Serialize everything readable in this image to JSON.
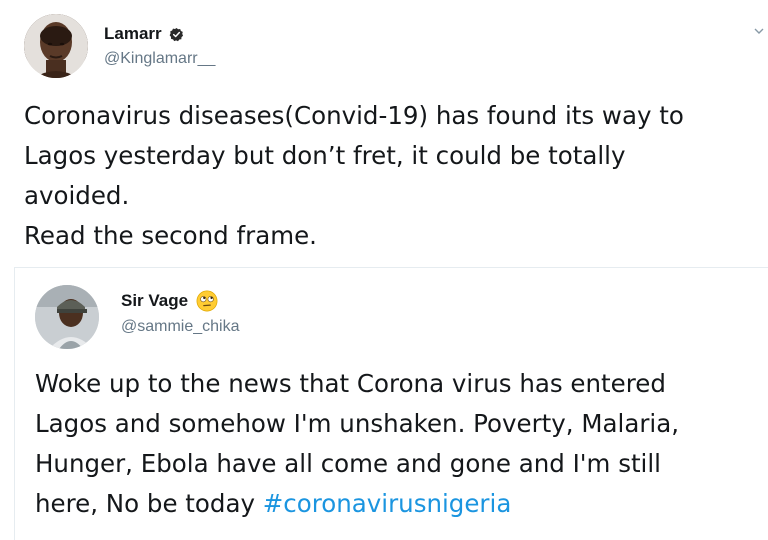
{
  "tweets": [
    {
      "author": {
        "name": "Lamarr",
        "handle": "@Kinglamarr__",
        "verified": true,
        "avatar_icon": "profile-photo"
      },
      "lines": [
        "Coronavirus diseases(Convid-19) has found its way to",
        "Lagos yesterday but don’t fret, it could be totally",
        "avoided.",
        "Read the second frame."
      ]
    },
    {
      "author": {
        "name": "Sir Vage",
        "handle": "@sammie_chika",
        "name_emoji": "face-with-rolling-eyes",
        "avatar_icon": "profile-photo"
      },
      "lines": [
        "Woke up to the news that Corona virus has entered",
        "Lagos and somehow I'm unshaken. Poverty, Malaria,",
        "Hunger, Ebola have all come and gone and I'm still"
      ],
      "last_line_prefix": "here, No be today ",
      "hashtag": "#coronavirusnigeria"
    }
  ],
  "colors": {
    "text": "#14171a",
    "secondary": "#657786",
    "link": "#1b95e0",
    "divider": "#e6ecf0"
  }
}
